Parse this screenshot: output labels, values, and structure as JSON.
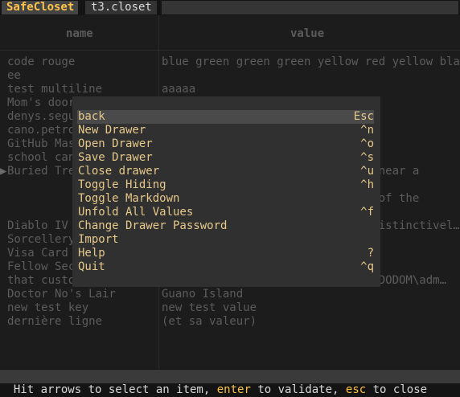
{
  "tabs": [
    {
      "label": "SafeCloset",
      "active": true
    },
    {
      "label": "t3.closet",
      "active": false
    }
  ],
  "table": {
    "headers": {
      "name": "name",
      "value": "value"
    },
    "rows": [
      {
        "name": "code rouge",
        "value": "blue green green green yellow red yellow blac…",
        "marker": ""
      },
      {
        "name": "ee",
        "value": "",
        "marker": ""
      },
      {
        "name": "test multiline",
        "value": "aaaaa",
        "marker": ""
      },
      {
        "name": "Mom's door",
        "value": "",
        "marker": ""
      },
      {
        "name": "denys.segu",
        "value": "",
        "marker": ""
      },
      {
        "name": "cano.petro",
        "value": "",
        "marker": ""
      },
      {
        "name": "GitHub Mas",
        "value": "",
        "marker": ""
      },
      {
        "name": "school can",
        "value": "",
        "marker": ""
      },
      {
        "name": "Buried Tre",
        "value": "                                near a",
        "marker": "▶"
      },
      {
        "name": "",
        "value": "",
        "marker": ""
      },
      {
        "name": "",
        "value": "                                of the",
        "marker": ""
      },
      {
        "name": "",
        "value": "",
        "marker": ""
      },
      {
        "name": "Diablo IV",
        "value": "                                istinctivel…",
        "marker": ""
      },
      {
        "name": "Sorcellery",
        "value": "",
        "marker": ""
      },
      {
        "name": "Visa Card",
        "value": "",
        "marker": ""
      },
      {
        "name": "Fellow Sec",
        "value": "",
        "marker": ""
      },
      {
        "name": "that custo",
        "value": "                               `DODOM\\adm…",
        "marker": ""
      },
      {
        "name": "Doctor No's Lair",
        "value": "Guano Island",
        "marker": ""
      },
      {
        "name": "new test key",
        "value": "new test value",
        "marker": ""
      },
      {
        "name": "dernière ligne",
        "value": "(et sa valeur)",
        "marker": ""
      }
    ]
  },
  "menu": {
    "items": [
      {
        "label": "back",
        "key": "Esc",
        "selected": true
      },
      {
        "label": "New Drawer",
        "key": "^n",
        "selected": false
      },
      {
        "label": "Open Drawer",
        "key": "^o",
        "selected": false
      },
      {
        "label": "Save Drawer",
        "key": "^s",
        "selected": false
      },
      {
        "label": "Close drawer",
        "key": "^u",
        "selected": false
      },
      {
        "label": "Toggle Hiding",
        "key": "^h",
        "selected": false
      },
      {
        "label": "Toggle Markdown",
        "key": "",
        "selected": false
      },
      {
        "label": "Unfold All Values",
        "key": "^f",
        "selected": false
      },
      {
        "label": "Change Drawer Password",
        "key": "",
        "selected": false
      },
      {
        "label": "Import",
        "key": "",
        "selected": false
      },
      {
        "label": "Help",
        "key": "?",
        "selected": false
      },
      {
        "label": "Quit",
        "key": "^q",
        "selected": false
      }
    ]
  },
  "status": {
    "part1": "Hit arrows to select an item, ",
    "key1": "enter",
    "part2": " to validate, ",
    "key2": "esc",
    "part3": " to close"
  },
  "colors": {
    "accent": "#ffc24a",
    "menu_text": "#e6c98a",
    "dim_text": "#5c5c5c"
  }
}
